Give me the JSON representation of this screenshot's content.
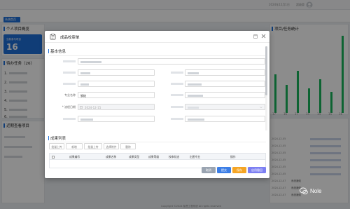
{
  "topbar": {
    "title": "",
    "time": "2024年12月1日",
    "user": "超级管"
  },
  "tabs": {
    "active": "系统首页"
  },
  "left": {
    "overview_title": "个人项目概览",
    "stat_label": "当前参与项目",
    "stat_value": "16",
    "todo_title": "待办任务（26）",
    "todo_items": [
      "1.",
      "2.",
      "3.",
      "4.",
      "5.",
      "6."
    ],
    "recent_title": "近期查看项目"
  },
  "right": {
    "stats_title": "项目/任务统计",
    "numbers": [
      "17",
      "16",
      "17",
      "15",
      "14",
      "15",
      "16"
    ],
    "news_dates": [
      "2024-12-05",
      "2024-12-05",
      "2024-12-05",
      "2024-12-05",
      "2024-12-05",
      "2024-12-05",
      "2024-12-07",
      "2024-12-07",
      "2024-12-07"
    ],
    "news_tag": "系统通知"
  },
  "modal": {
    "title": "成品校审单",
    "section_basic": "基本信息",
    "section_results": "成果列表",
    "fields": {
      "major_label": "专业名称",
      "major_value": "钢结",
      "date_label": "* 流程日期",
      "date_value": "2024-12-15"
    },
    "toolbar": [
      "批量上传",
      "新增",
      "批量上传",
      "选择附件",
      "删除"
    ],
    "table_headers": [
      "成果编号",
      "成果名称",
      "成果类型",
      "成果等级",
      "校审状态",
      "出图专业",
      "操作"
    ],
    "buttons": {
      "cancel": "取消",
      "submit": "提交",
      "save": "保存",
      "recall": "启用撤回"
    }
  },
  "footer": "Copyright ©2024 智慧工程系统 All rights reserved",
  "watermark": "Nole",
  "colors": {
    "accent": "#1e6fd9",
    "bar": "#19b45b"
  }
}
